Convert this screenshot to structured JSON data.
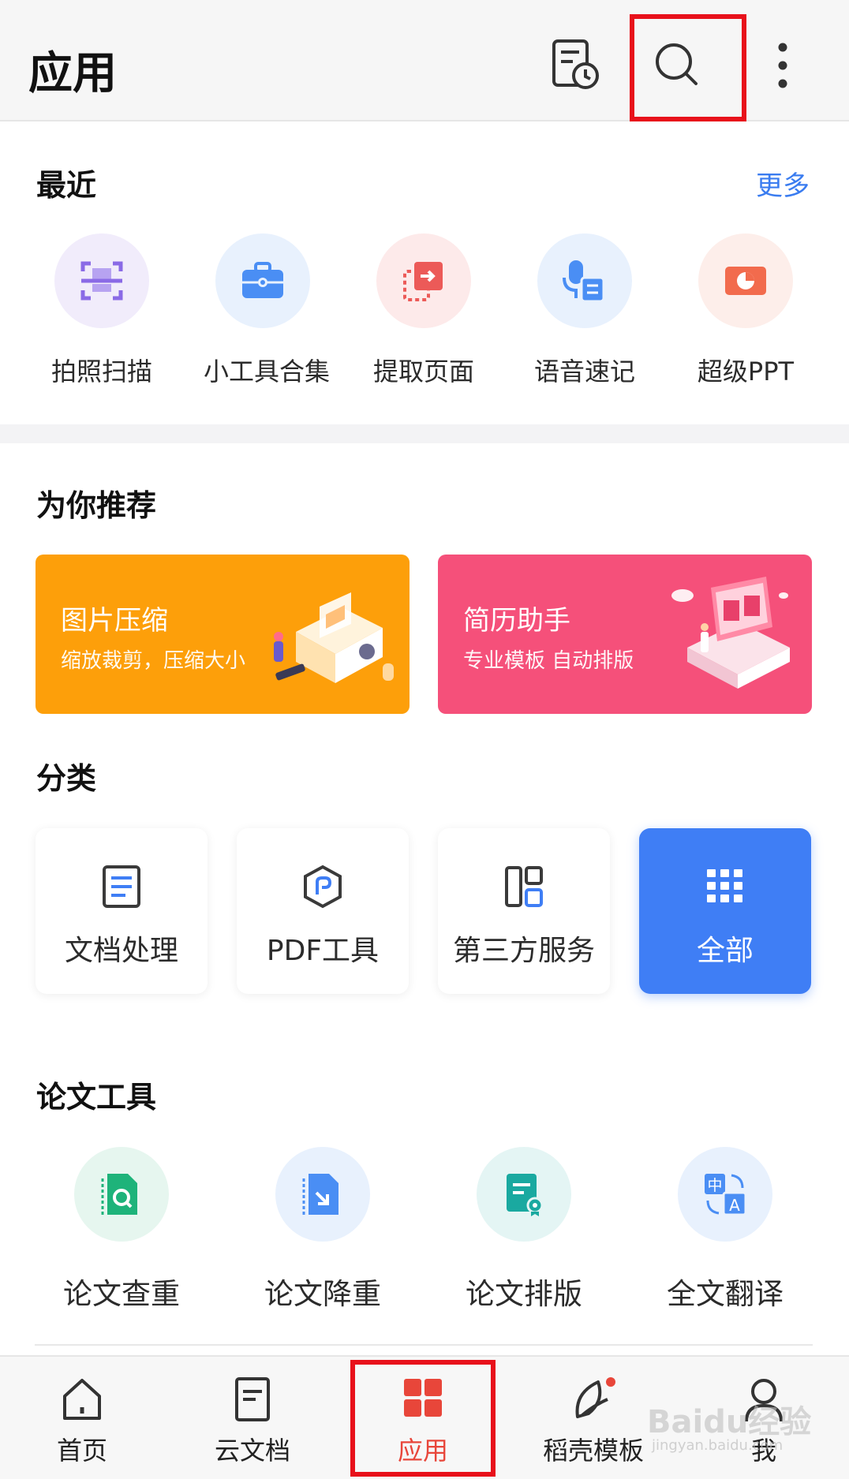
{
  "header": {
    "title": "应用",
    "icons": [
      "history-doc-icon",
      "search-icon",
      "more-vertical-icon"
    ]
  },
  "recent": {
    "title": "最近",
    "more_label": "更多",
    "items": [
      {
        "label": "拍照扫描",
        "icon": "scan-icon",
        "bg": "#f1ecfb",
        "color": "#8a6ae6"
      },
      {
        "label": "小工具合集",
        "icon": "toolbox-icon",
        "bg": "#e8f1fd",
        "color": "#4a8ef4"
      },
      {
        "label": "提取页面",
        "icon": "extract-page-icon",
        "bg": "#fdeaea",
        "color": "#ec5a58"
      },
      {
        "label": "语音速记",
        "icon": "voice-note-icon",
        "bg": "#e8f1fd",
        "color": "#4a8ef4"
      },
      {
        "label": "超级PPT",
        "icon": "ppt-icon",
        "bg": "#fdeeea",
        "color": "#f26b4d"
      }
    ]
  },
  "recommend": {
    "title": "为你推荐",
    "cards": [
      {
        "title": "图片压缩",
        "subtitle": "缩放裁剪，压缩大小",
        "bg": "#fd9f0a"
      },
      {
        "title": "简历助手",
        "subtitle": "专业模板 自动排版",
        "bg": "#f5507a"
      }
    ]
  },
  "category": {
    "title": "分类",
    "items": [
      {
        "label": "文档处理",
        "icon": "document-icon"
      },
      {
        "label": "PDF工具",
        "icon": "pdf-hexagon-icon"
      },
      {
        "label": "第三方服务",
        "icon": "layout-grid-icon"
      },
      {
        "label": "全部",
        "icon": "all-apps-icon"
      }
    ]
  },
  "thesis": {
    "title": "论文工具",
    "items": [
      {
        "label": "论文查重",
        "icon": "plagiarism-check-icon",
        "bg": "#e6f6ef",
        "color": "#1eb37a"
      },
      {
        "label": "论文降重",
        "icon": "reduce-duplicate-icon",
        "bg": "#e8f1fd",
        "color": "#4a8ef4"
      },
      {
        "label": "论文排版",
        "icon": "thesis-format-icon",
        "bg": "#e4f5f4",
        "color": "#1aa9a0"
      },
      {
        "label": "全文翻译",
        "icon": "translate-icon",
        "bg": "#e8f1fd",
        "color": "#4a8ef4"
      }
    ]
  },
  "bottom_nav": {
    "items": [
      {
        "label": "首页",
        "icon": "home-icon"
      },
      {
        "label": "云文档",
        "icon": "cloud-doc-icon"
      },
      {
        "label": "应用",
        "icon": "apps-grid-icon",
        "active": true
      },
      {
        "label": "稻壳模板",
        "icon": "leaf-template-icon"
      },
      {
        "label": "我",
        "icon": "person-icon"
      }
    ]
  },
  "watermark": {
    "text": "Baidu经验",
    "sub": "jingyan.baidu.com"
  },
  "colors": {
    "accent_blue": "#3f7ef5",
    "accent_red": "#e8463a",
    "highlight": "#e8111b"
  }
}
